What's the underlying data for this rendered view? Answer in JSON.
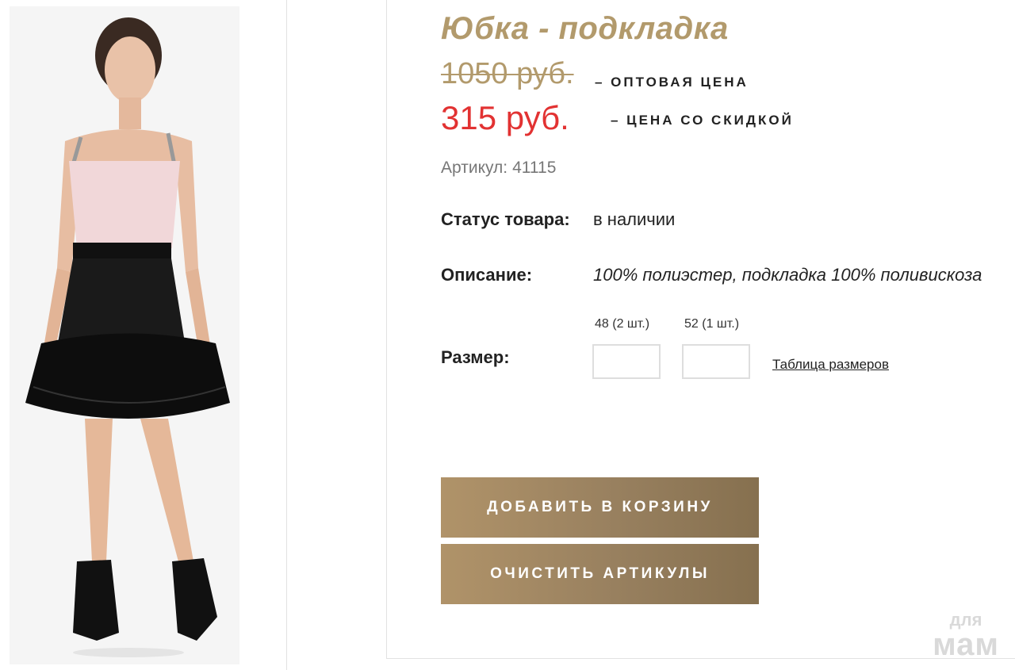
{
  "product": {
    "title": "Юбка - подкладка",
    "old_price": "1050 руб.",
    "old_price_label": "– ОПТОВАЯ ЦЕНА",
    "new_price": "315 руб.",
    "new_price_label": "– ЦЕНА СО СКИДКОЙ",
    "sku_label": "Артикул:",
    "sku_value": "41115",
    "status_label": "Статус товара:",
    "status_value": "в наличии",
    "description_label": "Описание:",
    "description_value": "100% полиэстер, подкладка 100% поливискоза",
    "size_label": "Размер:",
    "sizes": [
      {
        "caption": "48 (2 шт.)",
        "value": ""
      },
      {
        "caption": "52 (1 шт.)",
        "value": ""
      }
    ],
    "size_table_link": "Таблица размеров"
  },
  "actions": {
    "add_to_cart": "ДОБАВИТЬ В КОРЗИНУ",
    "clear_skus": "ОЧИСТИТЬ АРТИКУЛЫ"
  },
  "watermark": {
    "top": "для",
    "bottom": "мам"
  },
  "colors": {
    "accent_gold": "#b29a6c",
    "discount_red": "#e23232",
    "button_gradient_start": "#b09369",
    "button_gradient_end": "#86704f"
  },
  "icons": {
    "product_photo": "model-in-black-tulle-skirt-photo"
  }
}
